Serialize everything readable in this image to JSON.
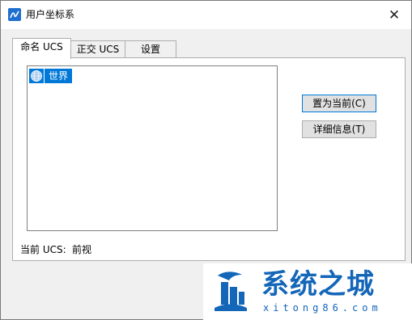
{
  "window": {
    "title": "用户坐标系",
    "close_glyph": "✕"
  },
  "tabs": [
    {
      "label": "命名 UCS",
      "active": true
    },
    {
      "label": "正交 UCS",
      "active": false
    },
    {
      "label": "设置",
      "active": false
    }
  ],
  "tree": {
    "items": [
      {
        "label": "世界",
        "icon": "globe-icon",
        "selected": true
      }
    ]
  },
  "buttons": {
    "set_current": "置为当前(C)",
    "details": "详细信息(T)"
  },
  "status": {
    "label": "当前 UCS:",
    "value": "前视"
  },
  "watermark": {
    "text": "系统之城",
    "url": "xitong86.com"
  },
  "colors": {
    "selection": "#0078d7",
    "watermark": "#1366b8"
  }
}
